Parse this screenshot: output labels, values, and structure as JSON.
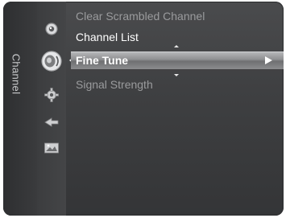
{
  "sidebar": {
    "label": "Channel"
  },
  "icons": [
    {
      "name": "picture-icon",
      "selected": false
    },
    {
      "name": "sound-icon",
      "selected": true
    },
    {
      "name": "settings-gear-icon",
      "selected": false
    },
    {
      "name": "input-icon",
      "selected": false
    },
    {
      "name": "application-icon",
      "selected": false
    }
  ],
  "menu": {
    "items": [
      {
        "label": "Clear Scrambled Channel",
        "state": "disabled"
      },
      {
        "label": "Channel List",
        "state": "enabled"
      },
      {
        "label": "Fine Tune",
        "state": "selected"
      },
      {
        "label": "Signal Strength",
        "state": "disabled"
      }
    ]
  },
  "colors": {
    "background": "#3f4042",
    "highlight": "#8f9092",
    "text": "#ffffff",
    "disabled_text": "#9a9b9d"
  }
}
